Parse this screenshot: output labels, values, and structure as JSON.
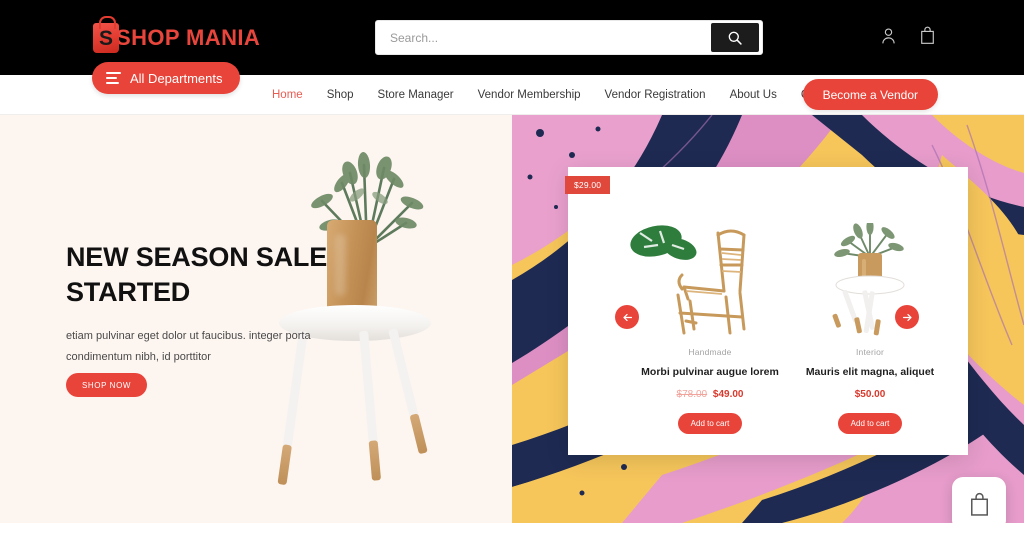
{
  "brand": {
    "name": "SHOP MANIA",
    "logo_icon": "shopping-bag-icon",
    "accent_color": "#e8443a"
  },
  "search": {
    "placeholder": "Search...",
    "value": "",
    "button_icon": "search-icon"
  },
  "header_icons": [
    {
      "name": "account-icon",
      "label": "Account"
    },
    {
      "name": "cart-icon",
      "label": "Cart"
    }
  ],
  "nav": {
    "departments_label": "All Departments",
    "departments_icon": "hamburger-icon",
    "links": [
      {
        "label": "Home",
        "active": true
      },
      {
        "label": "Shop",
        "active": false
      },
      {
        "label": "Store Manager",
        "active": false
      },
      {
        "label": "Vendor Membership",
        "active": false
      },
      {
        "label": "Vendor Registration",
        "active": false
      },
      {
        "label": "About Us",
        "active": false
      },
      {
        "label": "Contact",
        "active": false
      }
    ],
    "vendor_button": "Become a Vendor"
  },
  "hero": {
    "title": "NEW SEASON SALE STARTED",
    "description": "etiam pulvinar eget dolor ut faucibus. integer porta condimentum nibh, id porttitor",
    "cta": "SHOP NOW"
  },
  "promo": {
    "badge": "$29.00",
    "prev_icon": "arrow-left-icon",
    "next_icon": "arrow-right-icon",
    "products": [
      {
        "category": "Handmade",
        "name": "Morbi pulvinar augue lorem",
        "price_old": "$78.00",
        "price_new": "$49.00",
        "button": "Add to cart"
      },
      {
        "category": "Interior",
        "name": "Mauris elit magna, aliquet",
        "price_old": "",
        "price_new": "$50.00",
        "button": "Add to cart"
      }
    ]
  },
  "floating_cart": {
    "icon": "shopping-bag-icon"
  }
}
